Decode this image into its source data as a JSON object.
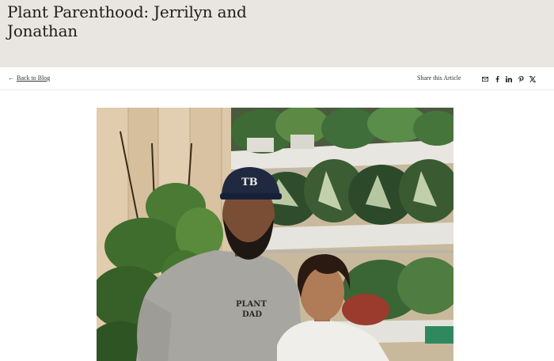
{
  "article": {
    "title": "Plant Parenthood: Jerrilyn and Jonathan"
  },
  "subnav": {
    "back_arrow": "←",
    "back_label": "Back to Blog",
    "share_label": "Share this Article",
    "share_icons": [
      "mail-icon",
      "facebook-icon",
      "linkedin-icon",
      "pinterest-icon",
      "x-icon"
    ]
  },
  "photo": {
    "shirt_text_line1": "PLANT",
    "shirt_text_line2": "DAD",
    "cap_logo": "TB"
  },
  "colors": {
    "hero_bg": "#e9e6e2",
    "text": "#1d1d1b"
  }
}
